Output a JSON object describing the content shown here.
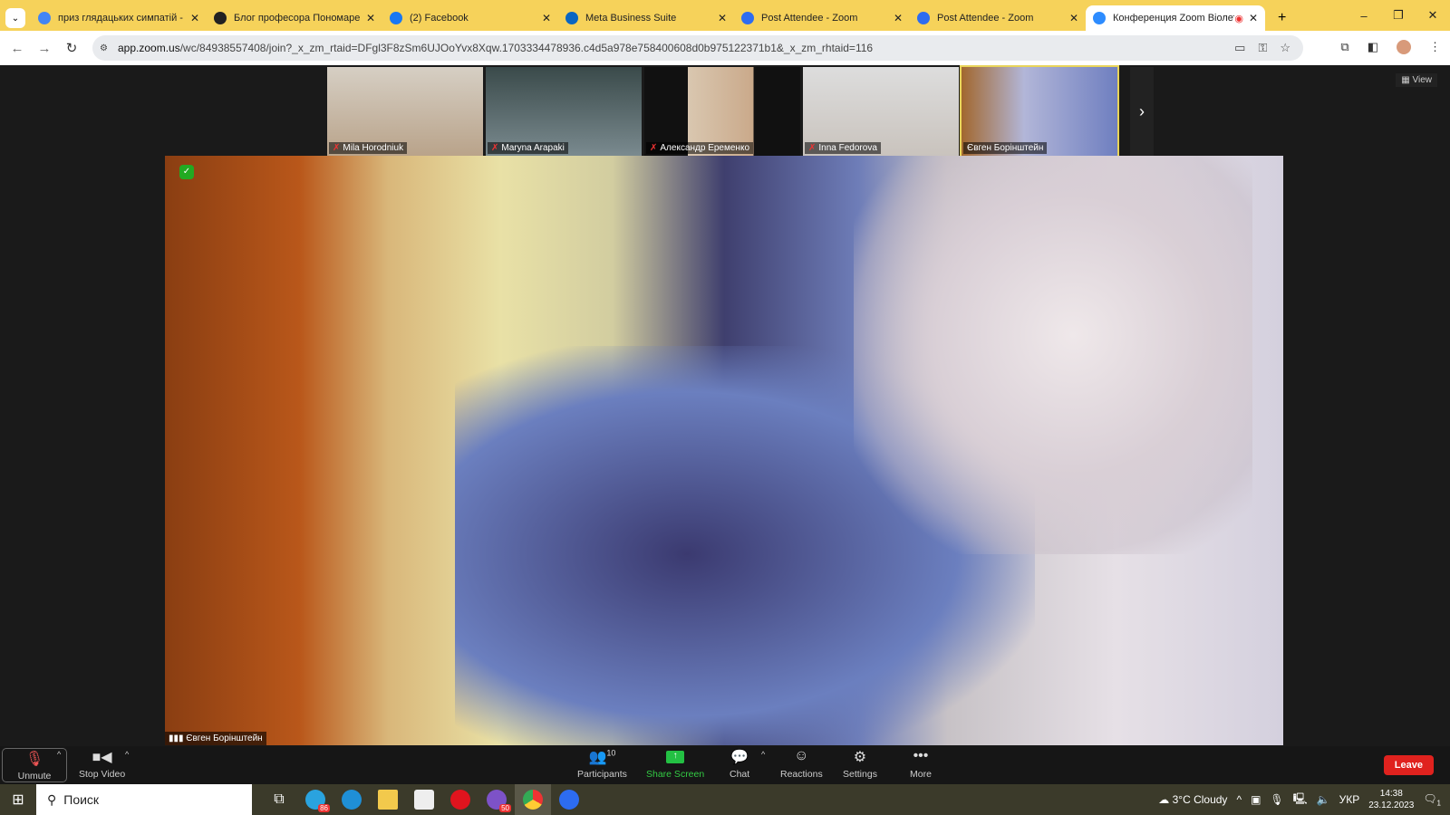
{
  "browser": {
    "tabs": [
      {
        "title": "приз глядацьких симпатій - По",
        "icon": "google-icon",
        "color": "#4285f4"
      },
      {
        "title": "Блог професора Пономарева",
        "icon": "blog-icon",
        "color": "#222222"
      },
      {
        "title": "(2) Facebook",
        "icon": "facebook-icon",
        "color": "#1877f2"
      },
      {
        "title": "Meta Business Suite",
        "icon": "meta-icon",
        "color": "#0a66c2"
      },
      {
        "title": "Post Attendee - Zoom",
        "icon": "zoom-icon",
        "color": "#2d6cf0"
      },
      {
        "title": "Post Attendee - Zoom",
        "icon": "zoom-icon",
        "color": "#2d6cf0"
      },
      {
        "title": "Конференция Zoom Віолетта",
        "icon": "zoom-icon",
        "color": "#2d8cff",
        "active": true
      }
    ],
    "url_domain": "app.zoom.us",
    "url_path": "/wc/84938557408/join?_x_zm_rtaid=DFgl3F8zSm6UJOoYvx8Xqw.1703334478936.c4d5a978e758400608d0b975122371b1&_x_zm_rhtaid=116"
  },
  "meeting": {
    "view_label": "View",
    "participants": [
      {
        "name": "Mila Horodniuk",
        "muted": true
      },
      {
        "name": "Maryna Arapaki",
        "muted": true
      },
      {
        "name": "Александр Еременко",
        "muted": true
      },
      {
        "name": "Inna Fedorova",
        "muted": true
      },
      {
        "name": "Євген Борінштейн",
        "muted": false,
        "active": true
      }
    ],
    "speaker_name": "Євген Борінштейн"
  },
  "toolbar": {
    "unmute": "Unmute",
    "stop_video": "Stop Video",
    "participants": "Participants",
    "participants_count": "10",
    "share_screen": "Share Screen",
    "chat": "Chat",
    "reactions": "Reactions",
    "settings": "Settings",
    "more": "More",
    "leave": "Leave"
  },
  "taskbar": {
    "search_placeholder": "Поиск",
    "telegram_badge": "86",
    "viber_badge": "50",
    "weather": "3°C  Cloudy",
    "lang": "УКР",
    "time": "14:38",
    "date": "23.12.2023",
    "notifications": "1"
  }
}
